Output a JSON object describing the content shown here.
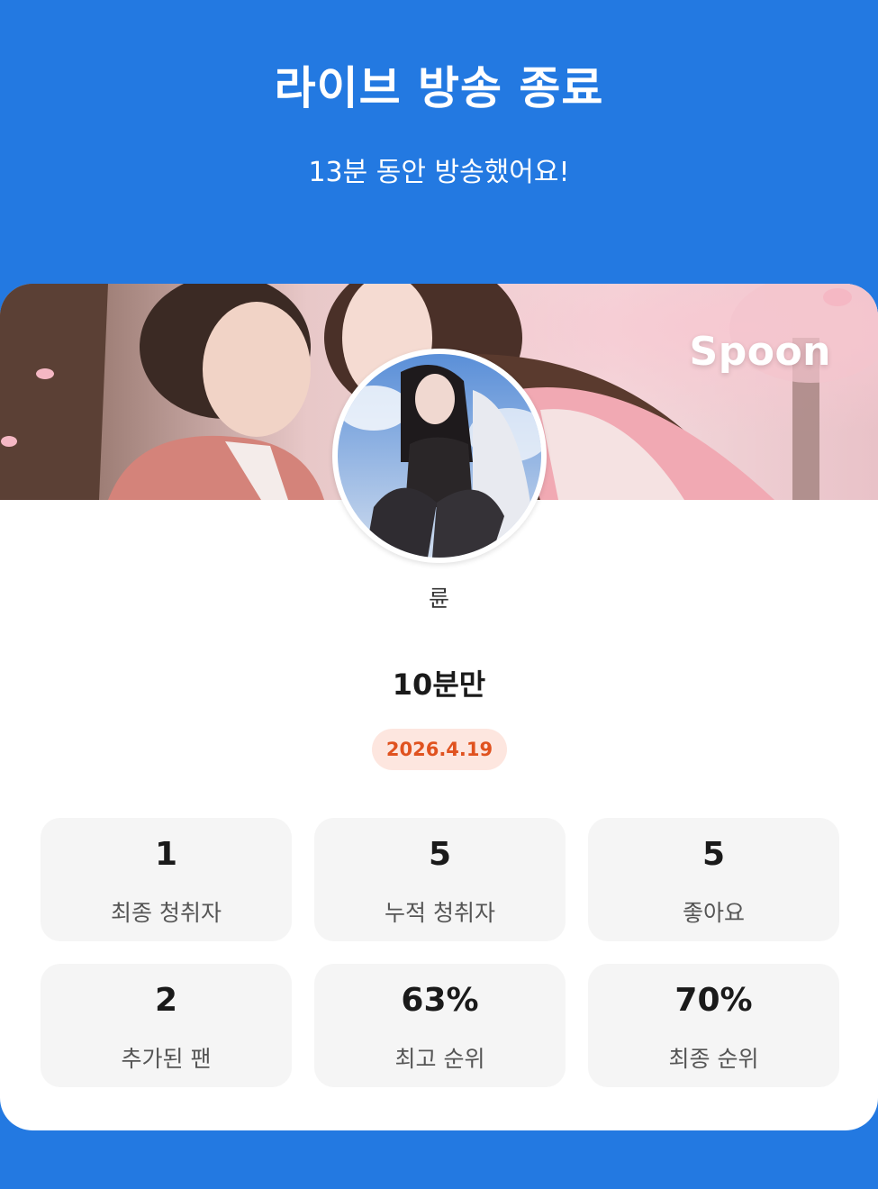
{
  "header": {
    "title": "라이브 방송 종료",
    "subtitle": "13분 동안 방송했어요!"
  },
  "banner": {
    "logo_text": "Spoon"
  },
  "profile": {
    "avatar_icon": "avatar-image",
    "name": "륜"
  },
  "live": {
    "title": "10분만",
    "date": "2026.4.19"
  },
  "stats": [
    {
      "value": "1",
      "label": "최종 청취자"
    },
    {
      "value": "5",
      "label": "누적 청취자"
    },
    {
      "value": "5",
      "label": "좋아요"
    },
    {
      "value": "2",
      "label": "추가된 팬"
    },
    {
      "value": "63%",
      "label": "최고 순위"
    },
    {
      "value": "70%",
      "label": "최종 순위"
    }
  ],
  "colors": {
    "background": "#2379e1",
    "card": "#ffffff",
    "stat_box": "#f5f5f5",
    "date_badge_bg": "#fde6df",
    "date_badge_text": "#e0521f"
  }
}
